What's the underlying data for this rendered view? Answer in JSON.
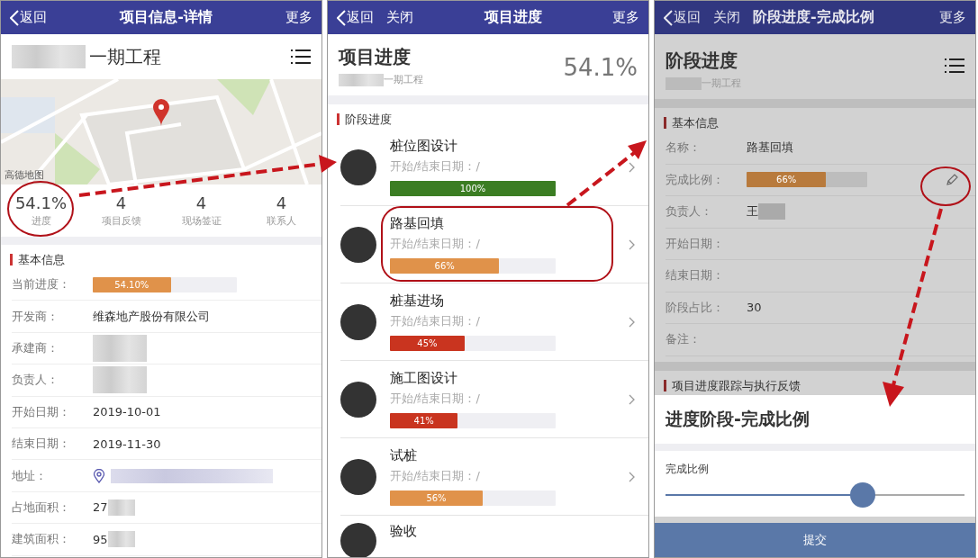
{
  "detail_screen": {
    "header": {
      "back": "返回",
      "title": "项目信息-详情",
      "more": "更多"
    },
    "project_title": "一期工程",
    "map": {
      "logo": "高德地图"
    },
    "stats": [
      {
        "value": "54.1%",
        "label": "进度",
        "highlighted": true
      },
      {
        "value": "4",
        "label": "项目反馈",
        "highlighted": false
      },
      {
        "value": "4",
        "label": "现场签证",
        "highlighted": false
      },
      {
        "value": "4",
        "label": "联系人",
        "highlighted": false
      }
    ],
    "section": "基本信息",
    "rows": [
      {
        "kind": "progress",
        "label": "当前进度：",
        "level": 0.541,
        "bar_label": "54.10%"
      },
      {
        "kind": "text",
        "label": "开发商：",
        "value": "维森地产股份有限公司"
      },
      {
        "kind": "redacted",
        "label": "承建商："
      },
      {
        "kind": "redacted",
        "label": "负责人："
      },
      {
        "kind": "text",
        "label": "开始日期：",
        "value": "2019-10-01"
      },
      {
        "kind": "text",
        "label": "结束日期：",
        "value": "2019-11-30"
      },
      {
        "kind": "address",
        "label": "地址："
      },
      {
        "kind": "partial",
        "label": "占地面积：",
        "value": "27"
      },
      {
        "kind": "partial",
        "label": "建筑面积：",
        "value": "95"
      }
    ]
  },
  "progress_screen": {
    "header": {
      "back": "返回",
      "close": "关闭",
      "title": "项目进度",
      "more": "更多"
    },
    "title": "项目进度",
    "subtitle": "一期工程",
    "percent": "54.1%",
    "section": "阶段进度",
    "stages": [
      {
        "name": "桩位图设计",
        "dates": "开始/结束日期：/",
        "level": 1,
        "bar_label": "100%",
        "color": "#3b7d23",
        "highlighted": false
      },
      {
        "name": "路基回填",
        "dates": "开始/结束日期：/",
        "level": 0.66,
        "bar_label": "66%",
        "color": "#e0924a",
        "highlighted": true
      },
      {
        "name": "桩基进场",
        "dates": "开始/结束日期：/",
        "level": 0.45,
        "bar_label": "45%",
        "color": "#c9341f",
        "highlighted": false
      },
      {
        "name": "施工图设计",
        "dates": "开始/结束日期：/",
        "level": 0.41,
        "bar_label": "41%",
        "color": "#c9341f",
        "highlighted": false
      },
      {
        "name": "试桩",
        "dates": "开始/结束日期：/",
        "level": 0.56,
        "bar_label": "56%",
        "color": "#e0924a",
        "highlighted": false
      },
      {
        "name": "验收",
        "highlighted": false
      }
    ]
  },
  "stage_screen": {
    "header": {
      "back": "返回",
      "close": "关闭",
      "title": "阶段进度-完成比例",
      "more": "更多"
    },
    "title": "阶段进度",
    "subtitle": "一期工程",
    "section": "基本信息",
    "rows": [
      {
        "kind": "text",
        "label": "名称：",
        "value": "路基回填"
      },
      {
        "kind": "progress",
        "label": "完成比例：",
        "level": 0.66,
        "bar_label": "66%",
        "editable": true
      },
      {
        "kind": "partial",
        "label": "负责人：",
        "value": "王"
      },
      {
        "kind": "text",
        "label": "开始日期："
      },
      {
        "kind": "text",
        "label": "结束日期："
      },
      {
        "kind": "text",
        "label": "阶段占比：",
        "value": "30"
      },
      {
        "kind": "text",
        "label": "备注："
      }
    ],
    "section_2": "项目进度跟踪与执行反馈",
    "sheet": {
      "title": "进度阶段-完成比例",
      "field_label": "完成比例",
      "level": 0.66,
      "submit": "提交"
    }
  }
}
